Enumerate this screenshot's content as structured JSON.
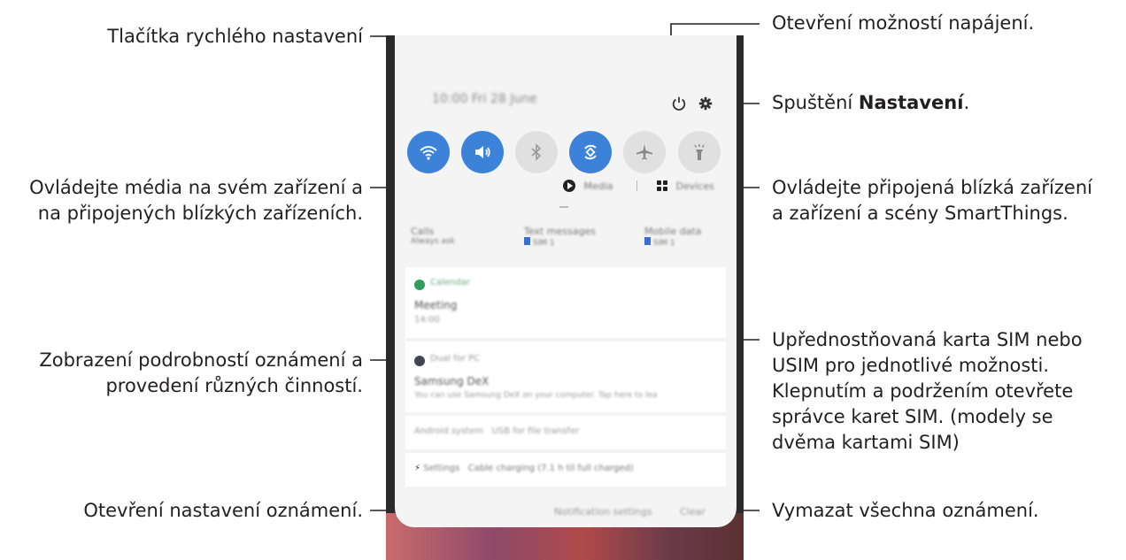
{
  "callouts": {
    "quick_settings": "Tlačítka rychlého nastavení",
    "power": "Otevření možností napájení.",
    "settings_prefix": "Spuštění ",
    "settings_bold": "Nastavení",
    "settings_suffix": ".",
    "media_line1": "Ovládejte média na svém zařízení a",
    "media_line2": "na připojených blízkých zařízeních.",
    "devices_line1": "Ovládejte připojená blízká zařízení",
    "devices_line2": "a zařízení a scény SmartThings.",
    "notif_line1": "Zobrazení podrobností oznámení a",
    "notif_line2": "provedení různých činností.",
    "sim_line1": "Upřednostňovaná karta SIM nebo",
    "sim_line2": "USIM pro jednotlivé možnosti.",
    "sim_line3": "Klepnutím a podržením otevřete",
    "sim_line4": "správce karet SIM. (modely se",
    "sim_line5": "dvěma kartami SIM)",
    "notif_settings": "Otevření nastavení oznámení.",
    "clear": "Vymazat všechna oznámení."
  },
  "phone": {
    "status_text": "10:00 Fri 28 June",
    "media_label": "Media",
    "devices_label": "Devices",
    "sim": [
      {
        "title": "Calls",
        "sub": "Always ask"
      },
      {
        "title": "Text messages",
        "sub": "SIM 1"
      },
      {
        "title": "Mobile data",
        "sub": "SIM 1"
      }
    ],
    "n1_app": "Calendar",
    "n1_title": "Meeting",
    "n1_body": "14:00",
    "n2_app": "Dual for PC",
    "n2_title": "Samsung DeX",
    "n2_body": "You can use Samsung DeX on your computer. Tap here to lea",
    "n3_app": "Android system",
    "n3_text": "USB for file transfer",
    "n4_app": "Settings",
    "n4_text": "Cable charging (7.1 h til full charged)",
    "notif_settings_btn": "Notification settings",
    "clear_btn": "Clear"
  },
  "colors": {
    "tile_on": "#3c82d8",
    "tile_off": "#e0e0e0",
    "callout_line": "#231f20"
  }
}
